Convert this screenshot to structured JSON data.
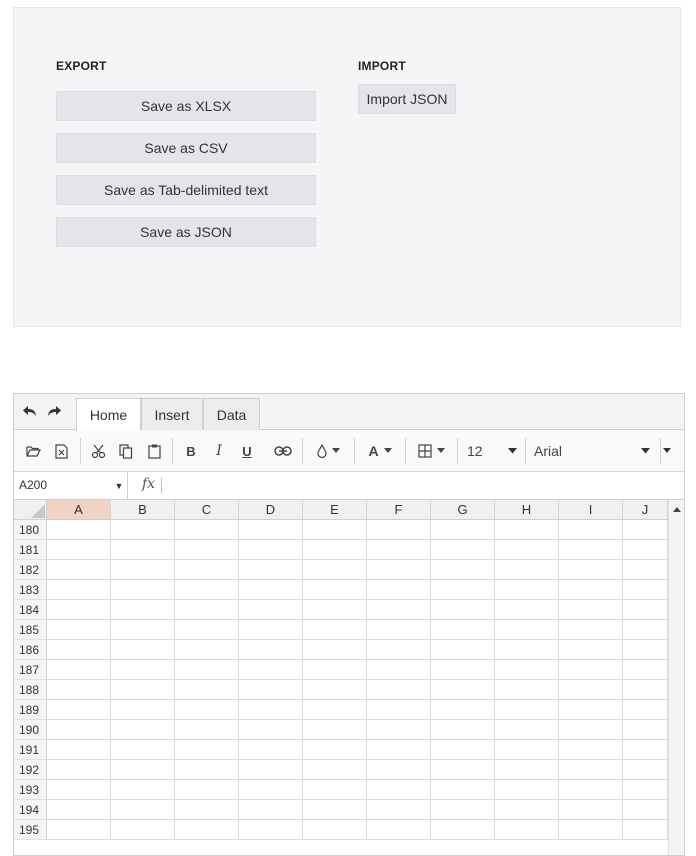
{
  "export": {
    "title": "EXPORT",
    "buttons": [
      "Save as XLSX",
      "Save as CSV",
      "Save as Tab-delimited text",
      "Save as JSON"
    ]
  },
  "import": {
    "title": "IMPORT",
    "button": "Import JSON"
  },
  "spreadsheet": {
    "tabs": [
      "Home",
      "Insert",
      "Data"
    ],
    "active_tab": "Home",
    "toolbar": {
      "icons": [
        "open-icon",
        "export-xlsx-icon",
        "cut-icon",
        "copy-icon",
        "paste-icon",
        "bold-icon",
        "italic-icon",
        "underline-icon",
        "link-icon",
        "fill-color-icon",
        "text-color-icon",
        "borders-icon"
      ],
      "bold_label": "B",
      "italic_label": "I",
      "underline_label": "U",
      "text_color_label": "A",
      "font_size": "12",
      "font_family": "Arial"
    },
    "name_box": "A200",
    "fx_label": "fx",
    "columns": [
      "A",
      "B",
      "C",
      "D",
      "E",
      "F",
      "G",
      "H",
      "I",
      "J"
    ],
    "selected_column": "A",
    "rows": [
      "180",
      "181",
      "182",
      "183",
      "184",
      "185",
      "186",
      "187",
      "188",
      "189",
      "190",
      "191",
      "192",
      "193",
      "194",
      "195"
    ]
  },
  "colors": {
    "panel_bg": "#f4f5f7",
    "button_bg": "#e4e5e8",
    "selected_header": "#f1d4c3"
  }
}
